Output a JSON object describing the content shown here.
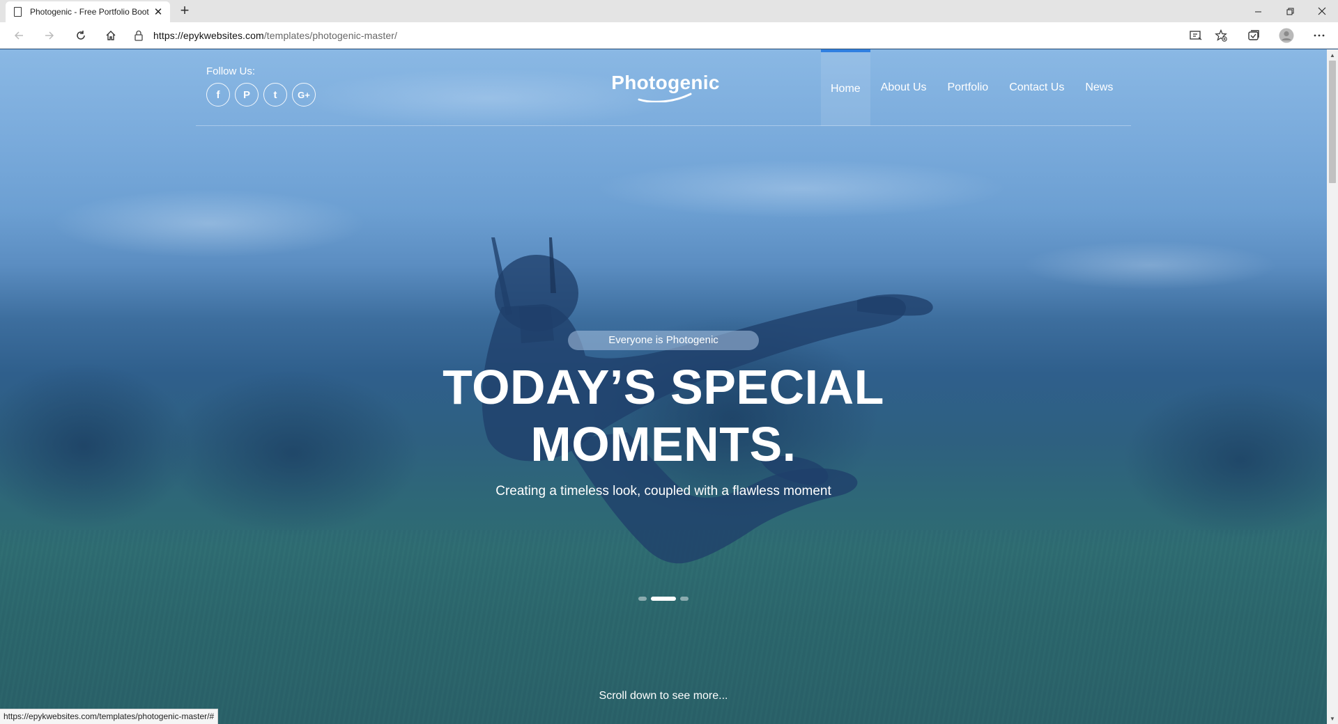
{
  "browser": {
    "tab_title": "Photogenic - Free Portfolio Boot",
    "new_tab_label": "+",
    "url_host": "https://epykwebsites.com",
    "url_path": "/templates/photogenic-master/",
    "status_url": "https://epykwebsites.com/templates/photogenic-master/#",
    "icons": [
      "page-icon",
      "close-icon",
      "minimize-icon",
      "restore-icon",
      "window-close-icon",
      "back-icon",
      "forward-icon",
      "refresh-icon",
      "home-icon",
      "lock-icon",
      "read-aloud-icon",
      "favorites-icon",
      "collections-icon",
      "profile-icon",
      "more-icon"
    ]
  },
  "site": {
    "follow_label": "Follow Us:",
    "socials": [
      {
        "name": "facebook-icon",
        "glyph": "f"
      },
      {
        "name": "pinterest-icon",
        "glyph": "P"
      },
      {
        "name": "twitter-icon",
        "glyph": "t"
      },
      {
        "name": "google-plus-icon",
        "glyph": "G+"
      }
    ],
    "logo": "Photogenic",
    "nav": [
      "Home",
      "About Us",
      "Portfolio",
      "Contact Us",
      "News"
    ],
    "active_nav": "Home",
    "accent_color": "#2f7fe0"
  },
  "hero": {
    "tag": "Everyone is Photogenic",
    "headline_line1": "TODAY’S SPECIAL",
    "headline_line2": "MOMENTS.",
    "subline": "Creating a timeless look, coupled with a flawless moment",
    "slides_count": 3,
    "active_slide": 2,
    "scroll_hint": "Scroll down to see more..."
  }
}
